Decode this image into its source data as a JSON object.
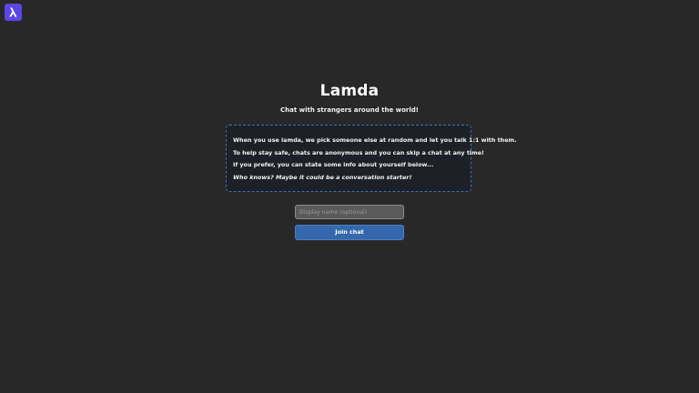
{
  "logo": {
    "icon": "lambda-icon",
    "color": "#5b46e8"
  },
  "app": {
    "title": "Lamda",
    "subtitle": "Chat with strangers around the world!"
  },
  "info": {
    "lines": [
      "When you use lamda, we pick someone else at random and let you talk 1:1 with them.",
      "To help stay safe, chats are anonymous and you can skip a chat at any time!",
      "If you prefer, you can state some info about yourself below...",
      "Who knows? Maybe it could be a conversation starter!"
    ]
  },
  "form": {
    "name_placeholder": "Display name (optional)",
    "name_value": "",
    "join_label": "Join chat"
  },
  "colors": {
    "background": "#282828",
    "accent": "#3567ad",
    "info_border": "#3d6fae"
  }
}
